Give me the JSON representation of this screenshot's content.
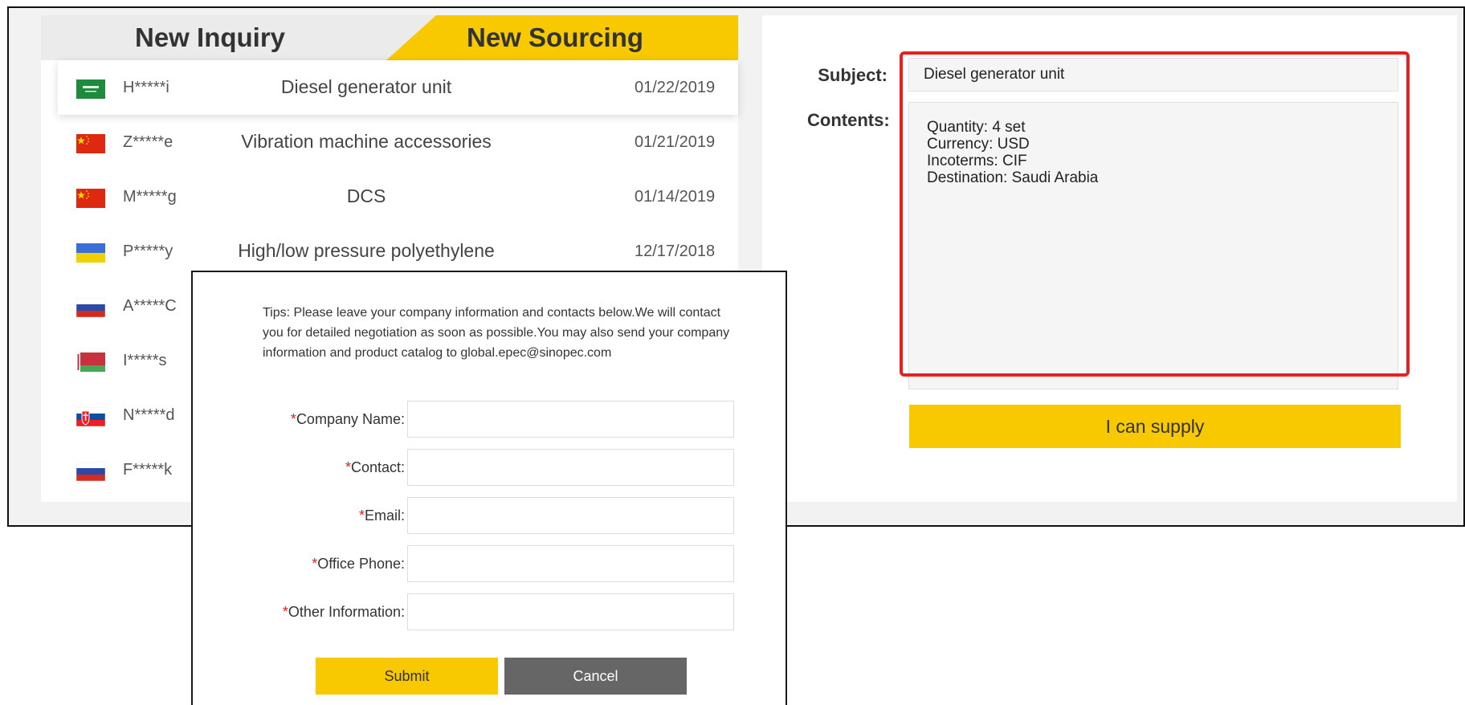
{
  "tabs": {
    "inquiry_label": "New Inquiry",
    "sourcing_label": "New Sourcing"
  },
  "list": [
    {
      "flag": "saudi-arabia-flag",
      "user": "H*****i",
      "subject": "Diesel generator unit",
      "date": "01/22/2019",
      "active": true
    },
    {
      "flag": "china-flag",
      "user": "Z*****e",
      "subject": "Vibration machine accessories",
      "date": "01/21/2019"
    },
    {
      "flag": "china-flag",
      "user": "M*****g",
      "subject": "DCS",
      "date": "01/14/2019"
    },
    {
      "flag": "ukraine-flag",
      "user": "P*****y",
      "subject": "High/low pressure polyethylene",
      "date": "12/17/2018"
    },
    {
      "flag": "russia-flag",
      "user": "A*****C",
      "subject": "",
      "date": ""
    },
    {
      "flag": "belarus-flag",
      "user": "I*****s",
      "subject": "",
      "date": ""
    },
    {
      "flag": "slovakia-flag",
      "user": "N*****d",
      "subject": "",
      "date": ""
    },
    {
      "flag": "russia-flag",
      "user": "F*****k",
      "subject": "",
      "date": ""
    }
  ],
  "detail": {
    "subject_label": "Subject:",
    "contents_label": "Contents:",
    "subject_value": "Diesel generator unit",
    "contents_lines": [
      "Quantity: 4 set",
      "Currency: USD",
      "Incoterms: CIF",
      "Destination: Saudi Arabia"
    ],
    "supply_button": "I can supply"
  },
  "modal": {
    "tips": "Tips: Please leave your company information and contacts below.We will contact you for detailed negotiation as soon as possible.You may also send your company information and product catalog to global.epec@sinopec.com",
    "required_mark": "*",
    "fields": [
      {
        "label": "Company Name:"
      },
      {
        "label": "Contact:"
      },
      {
        "label": "Email:"
      },
      {
        "label": "Office Phone:"
      },
      {
        "label": "Other Information:"
      }
    ],
    "submit_label": "Submit",
    "cancel_label": "Cancel"
  },
  "colors": {
    "accent_yellow": "#f8c800",
    "highlight_red": "#e82020",
    "cancel_gray": "#666666"
  }
}
